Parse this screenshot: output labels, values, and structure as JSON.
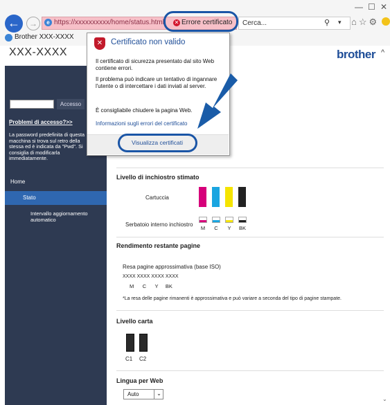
{
  "browser": {
    "address": "https://xxxxxxxxxx/home/status.html",
    "cert_error_label": "Errore certificato",
    "search_placeholder": "Cerca...",
    "tab_title": "Brother XXX-XXXX",
    "colors": {
      "address_bg": "#f7c0c8",
      "accent": "#1a55a6"
    }
  },
  "header": {
    "model": "XXX-XXXX",
    "brand": "brother"
  },
  "sidebar": {
    "login_button": "Accesso",
    "forgot_link": "Problemi di accesso?>>",
    "password_note": "La password predefinita di questa macchina si trova sul retro della stessa ed è indicata da \"Pwd\". Si consiglia di modificarla immediatamente.",
    "home": "Home",
    "status": "Stato",
    "refresh_interval": "Intervallo aggiornamento automatico"
  },
  "popup": {
    "title": "Certificato non valido",
    "p1": "Il certificato di sicurezza presentato dal sito Web contiene errori.",
    "p2": "Il problema può indicare un tentativo di ingannare l'utente o di intercettare i dati inviati al server.",
    "p3": "È consigliabile chiudere la pagina Web.",
    "link": "Informazioni sugli errori del certificato",
    "view_button": "Visualizza certificati"
  },
  "ink": {
    "title": "Livello di inchiostro stimato",
    "cartridge_label": "Cartuccia",
    "tank_label": "Serbatoio interno inchiostro",
    "colors": [
      {
        "label": "M",
        "hex": "#d6007a"
      },
      {
        "label": "C",
        "hex": "#1aa5e0"
      },
      {
        "label": "Y",
        "hex": "#f5e400"
      },
      {
        "label": "BK",
        "hex": "#222222"
      }
    ]
  },
  "yield": {
    "title": "Rendimento restante pagine",
    "subtitle": "Resa pagine approssimativa (base ISO)",
    "values": "XXXX  XXXX  XXXX  XXXX",
    "labels": "M      C      Y     BK",
    "note": "*La resa delle pagine rimanenti è approssimativa e può variare a seconda del tipo di pagine stampate."
  },
  "paper": {
    "title": "Livello carta",
    "trays": [
      "C1",
      "C2"
    ]
  },
  "language": {
    "title": "Lingua per Web",
    "selected": "Auto"
  }
}
